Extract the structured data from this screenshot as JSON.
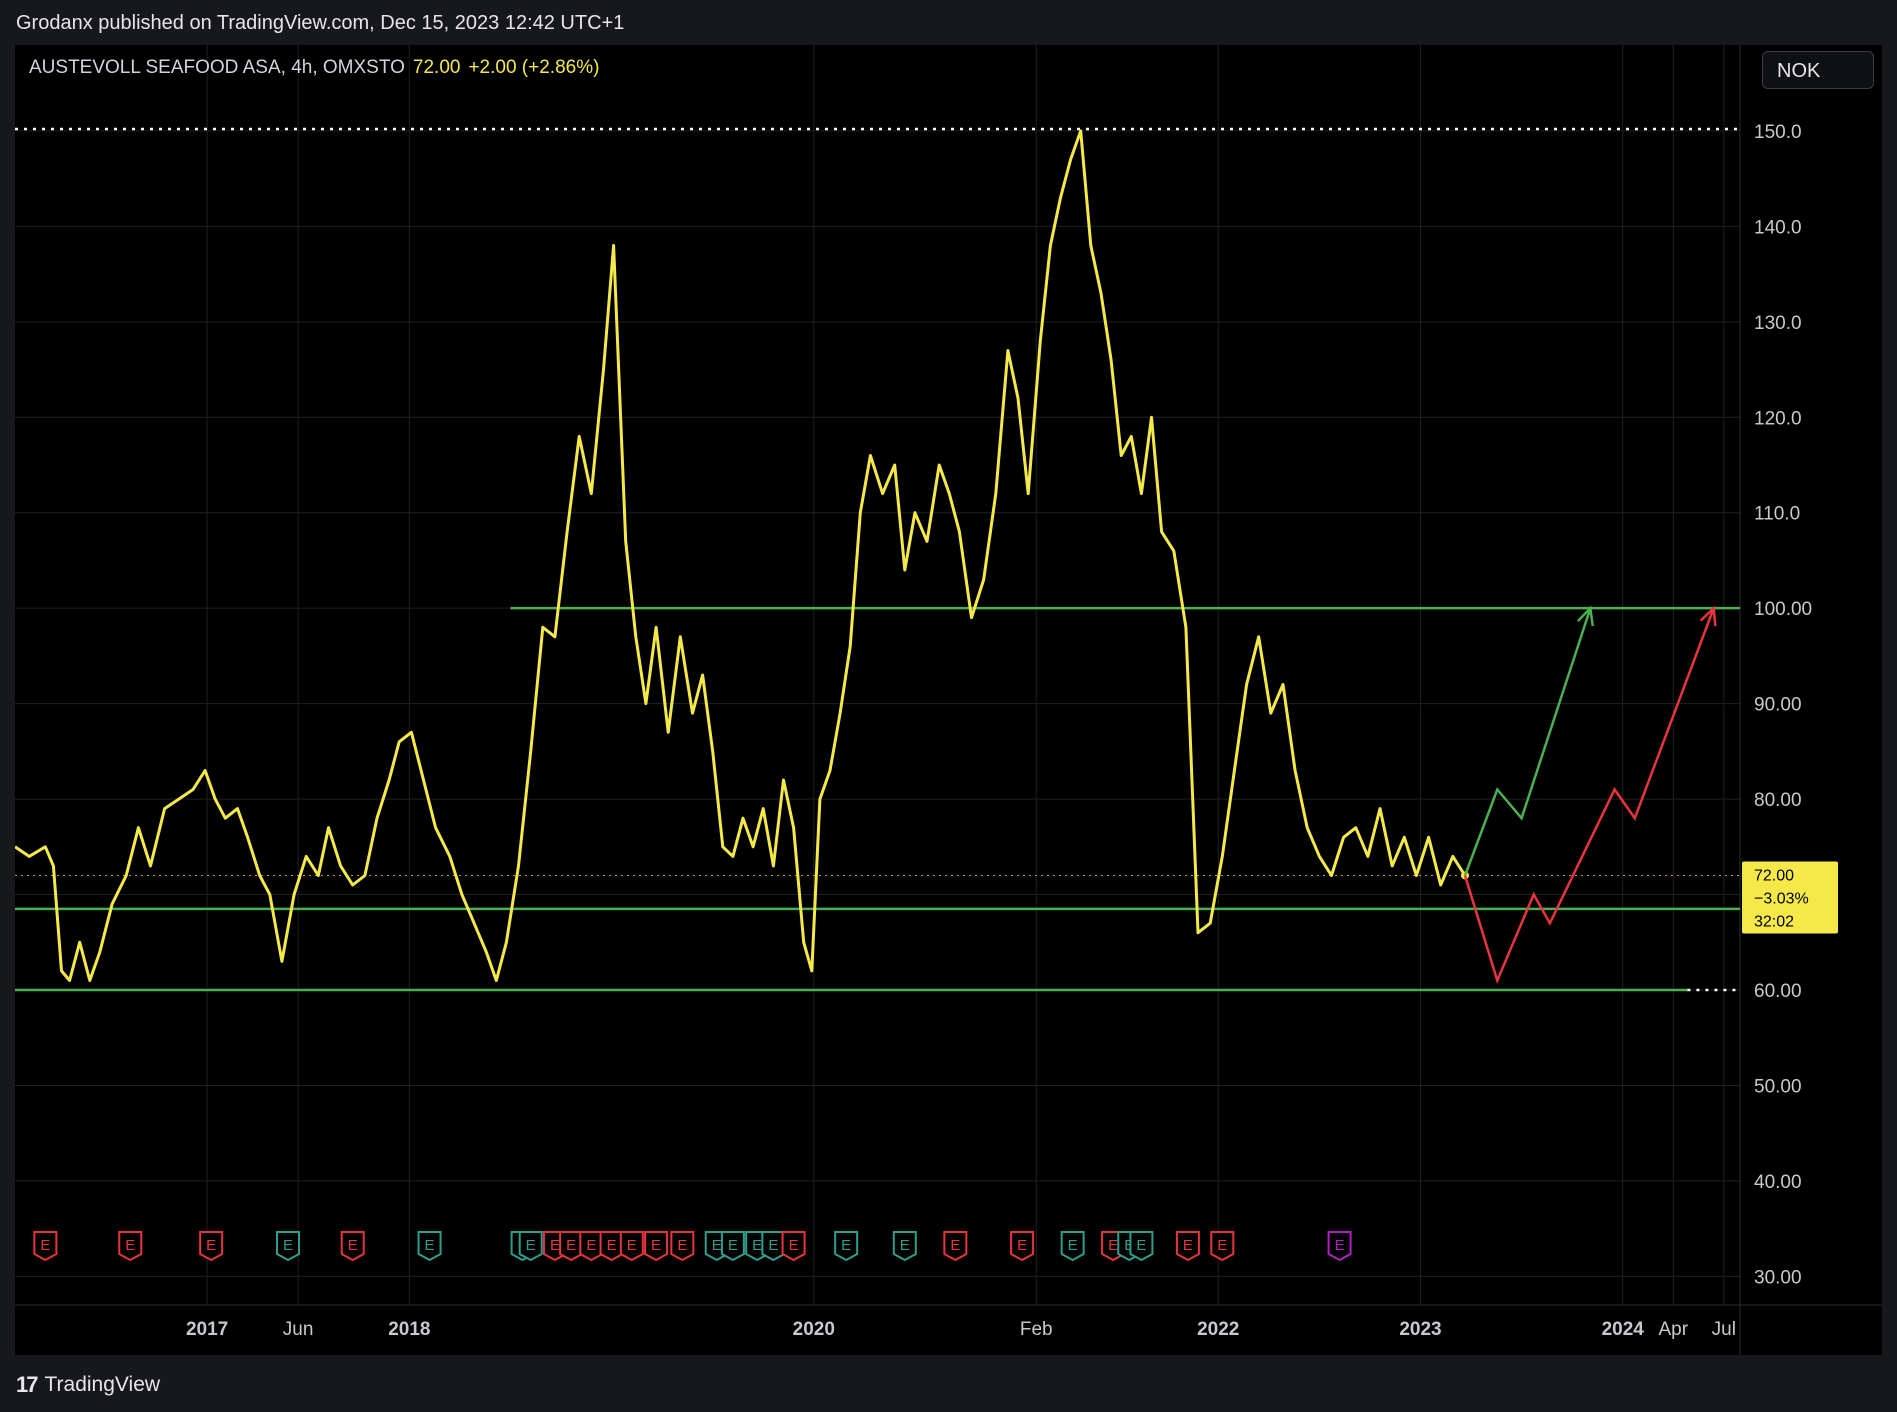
{
  "publisher": "Grodanx published on TradingView.com, Dec 15, 2023 12:42 UTC+1",
  "legend": {
    "symbol": "AUSTEVOLL SEAFOOD ASA, 4h, OMXSTO",
    "price": "72.00",
    "change": "+2.00 (+2.86%)"
  },
  "currency_button": "NOK",
  "price_badge": {
    "price": "72.00",
    "change": "−3.03%",
    "countdown": "32:02"
  },
  "footer": {
    "brand": "TradingView"
  },
  "colors": {
    "price_line": "#f5e94a",
    "level_line": "#4caf50",
    "bull_projection": "#4caf50",
    "bear_projection": "#e8343f",
    "earnings_past": "#e8343f",
    "earnings_positive": "#2e9e8f",
    "earnings_future": "#b020c0"
  },
  "chart_data": {
    "type": "line",
    "yaxis": {
      "ticks": [
        "150.0",
        "140.0",
        "130.0",
        "120.0",
        "110.0",
        "100.00",
        "90.00",
        "80.00",
        "70.00",
        "60.00",
        "50.00",
        "40.00",
        "30.00"
      ],
      "ylim": [
        27,
        159
      ]
    },
    "xaxis": {
      "ticks": [
        {
          "label": "2017",
          "bold": true,
          "x": 2017.0
        },
        {
          "label": "Jun",
          "bold": false,
          "x": 2017.45
        },
        {
          "label": "2018",
          "bold": true,
          "x": 2018.0
        },
        {
          "label": "2020",
          "bold": true,
          "x": 2020.0
        },
        {
          "label": "Feb",
          "bold": false,
          "x": 2021.1
        },
        {
          "label": "2022",
          "bold": true,
          "x": 2022.0
        },
        {
          "label": "2023",
          "bold": true,
          "x": 2023.0
        },
        {
          "label": "2024",
          "bold": true,
          "x": 2024.0
        },
        {
          "label": "Apr",
          "bold": false,
          "x": 2024.25
        },
        {
          "label": "Jul",
          "bold": false,
          "x": 2024.5
        }
      ],
      "xlim": [
        2016.05,
        2024.58
      ]
    },
    "series": [
      {
        "points": [
          [
            2016.05,
            75
          ],
          [
            2016.12,
            74
          ],
          [
            2016.2,
            75
          ],
          [
            2016.24,
            73
          ],
          [
            2016.28,
            62
          ],
          [
            2016.32,
            61
          ],
          [
            2016.37,
            65
          ],
          [
            2016.42,
            61
          ],
          [
            2016.47,
            64
          ],
          [
            2016.53,
            69
          ],
          [
            2016.6,
            72
          ],
          [
            2016.66,
            77
          ],
          [
            2016.72,
            73
          ],
          [
            2016.79,
            79
          ],
          [
            2016.86,
            80
          ],
          [
            2016.93,
            81
          ],
          [
            2016.99,
            83
          ],
          [
            2017.04,
            80
          ],
          [
            2017.09,
            78
          ],
          [
            2017.15,
            79
          ],
          [
            2017.2,
            76
          ],
          [
            2017.26,
            72
          ],
          [
            2017.31,
            70
          ],
          [
            2017.37,
            63
          ],
          [
            2017.43,
            70
          ],
          [
            2017.49,
            74
          ],
          [
            2017.55,
            72
          ],
          [
            2017.6,
            77
          ],
          [
            2017.66,
            73
          ],
          [
            2017.72,
            71
          ],
          [
            2017.78,
            72
          ],
          [
            2017.84,
            78
          ],
          [
            2017.9,
            82
          ],
          [
            2017.95,
            86
          ],
          [
            2018.01,
            87
          ],
          [
            2018.07,
            82
          ],
          [
            2018.13,
            77
          ],
          [
            2018.2,
            74
          ],
          [
            2018.26,
            70
          ],
          [
            2018.32,
            67
          ],
          [
            2018.38,
            64
          ],
          [
            2018.43,
            61
          ],
          [
            2018.48,
            65
          ],
          [
            2018.54,
            73
          ],
          [
            2018.6,
            85
          ],
          [
            2018.66,
            98
          ],
          [
            2018.72,
            97
          ],
          [
            2018.78,
            108
          ],
          [
            2018.84,
            118
          ],
          [
            2018.9,
            112
          ],
          [
            2018.96,
            125
          ],
          [
            2019.01,
            138
          ],
          [
            2019.07,
            107
          ],
          [
            2019.12,
            97
          ],
          [
            2019.17,
            90
          ],
          [
            2019.22,
            98
          ],
          [
            2019.28,
            87
          ],
          [
            2019.34,
            97
          ],
          [
            2019.4,
            89
          ],
          [
            2019.45,
            93
          ],
          [
            2019.5,
            85
          ],
          [
            2019.55,
            75
          ],
          [
            2019.6,
            74
          ],
          [
            2019.65,
            78
          ],
          [
            2019.7,
            75
          ],
          [
            2019.75,
            79
          ],
          [
            2019.8,
            73
          ],
          [
            2019.85,
            82
          ],
          [
            2019.9,
            77
          ],
          [
            2019.95,
            65
          ],
          [
            2019.99,
            62
          ],
          [
            2020.03,
            80
          ],
          [
            2020.08,
            83
          ],
          [
            2020.13,
            89
          ],
          [
            2020.18,
            96
          ],
          [
            2020.23,
            110
          ],
          [
            2020.28,
            116
          ],
          [
            2020.34,
            112
          ],
          [
            2020.4,
            115
          ],
          [
            2020.45,
            104
          ],
          [
            2020.5,
            110
          ],
          [
            2020.56,
            107
          ],
          [
            2020.62,
            115
          ],
          [
            2020.67,
            112
          ],
          [
            2020.72,
            108
          ],
          [
            2020.78,
            99
          ],
          [
            2020.84,
            103
          ],
          [
            2020.9,
            112
          ],
          [
            2020.96,
            127
          ],
          [
            2021.01,
            122
          ],
          [
            2021.06,
            112
          ],
          [
            2021.12,
            128
          ],
          [
            2021.17,
            138
          ],
          [
            2021.22,
            143
          ],
          [
            2021.27,
            147
          ],
          [
            2021.32,
            150
          ],
          [
            2021.37,
            138
          ],
          [
            2021.42,
            133
          ],
          [
            2021.47,
            126
          ],
          [
            2021.52,
            116
          ],
          [
            2021.57,
            118
          ],
          [
            2021.62,
            112
          ],
          [
            2021.67,
            120
          ],
          [
            2021.72,
            108
          ],
          [
            2021.78,
            106
          ],
          [
            2021.84,
            98
          ],
          [
            2021.9,
            66
          ],
          [
            2021.96,
            67
          ],
          [
            2022.02,
            74
          ],
          [
            2022.08,
            83
          ],
          [
            2022.14,
            92
          ],
          [
            2022.2,
            97
          ],
          [
            2022.26,
            89
          ],
          [
            2022.32,
            92
          ],
          [
            2022.38,
            83
          ],
          [
            2022.44,
            77
          ],
          [
            2022.5,
            74
          ],
          [
            2022.56,
            72
          ],
          [
            2022.62,
            76
          ],
          [
            2022.68,
            77
          ],
          [
            2022.74,
            74
          ],
          [
            2022.8,
            79
          ],
          [
            2022.86,
            73
          ],
          [
            2022.92,
            76
          ],
          [
            2022.98,
            72
          ],
          [
            2023.04,
            76
          ],
          [
            2023.1,
            71
          ],
          [
            2023.16,
            74
          ],
          [
            2023.22,
            72
          ]
        ]
      }
    ],
    "levels": [
      {
        "value": 150.2,
        "style": "dotted",
        "color": "#ffffff",
        "x0": 2016.05,
        "x1": 2024.58
      },
      {
        "value": 100,
        "style": "solid",
        "color": "#4caf50",
        "x0": 2018.5,
        "x1": 2024.58
      },
      {
        "value": 68.5,
        "style": "solid",
        "color": "#4caf50",
        "x0": 2016.05,
        "x1": 2024.58
      },
      {
        "value": 60,
        "style": "solid",
        "color": "#4caf50",
        "x0": 2016.05,
        "x1": 2024.32
      },
      {
        "value": 60,
        "style": "dotted",
        "color": "#ffffff",
        "x0": 2024.32,
        "x1": 2024.58
      },
      {
        "value": 72,
        "style": "dotted",
        "color": "#c8a040",
        "x0": 2016.05,
        "x1": 2024.58
      }
    ],
    "projections": [
      {
        "name": "",
        "color": "#4caf50",
        "points": [
          [
            2023.22,
            72
          ],
          [
            2023.38,
            81
          ],
          [
            2023.5,
            78
          ],
          [
            2023.84,
            100
          ]
        ]
      },
      {
        "name": "",
        "color": "#e8343f",
        "points": [
          [
            2023.22,
            72
          ],
          [
            2023.38,
            61
          ],
          [
            2023.56,
            70
          ],
          [
            2023.64,
            67
          ],
          [
            2023.96,
            81
          ],
          [
            2024.06,
            78
          ],
          [
            2024.45,
            100
          ]
        ]
      }
    ],
    "earnings": [
      {
        "x": 2016.2,
        "type": "past"
      },
      {
        "x": 2016.62,
        "type": "past"
      },
      {
        "x": 2017.02,
        "type": "past"
      },
      {
        "x": 2017.4,
        "type": "positive"
      },
      {
        "x": 2017.72,
        "type": "past"
      },
      {
        "x": 2018.1,
        "type": "positive"
      },
      {
        "x": 2018.56,
        "type": "positive"
      },
      {
        "x": 2018.6,
        "type": "positive"
      },
      {
        "x": 2018.72,
        "type": "past"
      },
      {
        "x": 2018.8,
        "type": "past"
      },
      {
        "x": 2018.9,
        "type": "past"
      },
      {
        "x": 2019.0,
        "type": "past"
      },
      {
        "x": 2019.1,
        "type": "past"
      },
      {
        "x": 2019.22,
        "type": "past"
      },
      {
        "x": 2019.35,
        "type": "past"
      },
      {
        "x": 2019.52,
        "type": "positive"
      },
      {
        "x": 2019.6,
        "type": "positive"
      },
      {
        "x": 2019.72,
        "type": "positive"
      },
      {
        "x": 2019.8,
        "type": "positive"
      },
      {
        "x": 2019.9,
        "type": "past"
      },
      {
        "x": 2020.16,
        "type": "positive"
      },
      {
        "x": 2020.45,
        "type": "positive"
      },
      {
        "x": 2020.7,
        "type": "past"
      },
      {
        "x": 2021.03,
        "type": "past"
      },
      {
        "x": 2021.28,
        "type": "positive"
      },
      {
        "x": 2021.48,
        "type": "past"
      },
      {
        "x": 2021.56,
        "type": "positive"
      },
      {
        "x": 2021.62,
        "type": "positive"
      },
      {
        "x": 2021.85,
        "type": "past"
      },
      {
        "x": 2022.02,
        "type": "past"
      },
      {
        "x": 2022.6,
        "type": "future"
      }
    ]
  }
}
